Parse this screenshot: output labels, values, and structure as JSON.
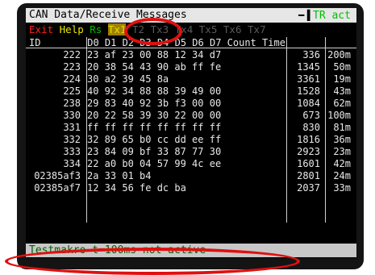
{
  "title": "CAN Data/Receive Messages",
  "tr_icon": "plug-icon",
  "tr_label": "TR act",
  "menu": {
    "exit": "Exit",
    "help": "Help",
    "rs": "Rs",
    "tabs": [
      "Tx1",
      "T2",
      "Tx3",
      "Tx4",
      "Tx5",
      "Tx6",
      "Tx7"
    ],
    "selected_tab": "Tx1"
  },
  "columns": {
    "id": "ID",
    "data": "D0 D1 D2 D3 D4 D5 D6 D7",
    "count": "Count",
    "time": "Time"
  },
  "rows": [
    {
      "id": "222",
      "data": "23 af 23 00 88 12 34 d7",
      "count": "336",
      "time": "200m"
    },
    {
      "id": "223",
      "data": "20 38 54 43 90 ab ff fe",
      "count": "1345",
      "time": "50m"
    },
    {
      "id": "224",
      "data": "30 a2 39 45 8a",
      "count": "3361",
      "time": "19m"
    },
    {
      "id": "225",
      "data": "40 92 34 88 88 39 49 00",
      "count": "1528",
      "time": "43m"
    },
    {
      "id": "238",
      "data": "29 83 40 92 3b f3 00 00",
      "count": "1084",
      "time": "62m"
    },
    {
      "id": "330",
      "data": "20 22 58 39 30 22 00 00",
      "count": "673",
      "time": "100m"
    },
    {
      "id": "331",
      "data": "ff ff ff ff ff ff ff ff",
      "count": "830",
      "time": "81m"
    },
    {
      "id": "332",
      "data": "32 89 65 b0 cc dd ee ff",
      "count": "1816",
      "time": "36m"
    },
    {
      "id": "333",
      "data": "23 84 09 bf 33 87 77 30",
      "count": "2923",
      "time": "23m"
    },
    {
      "id": "334",
      "data": "22 a0 b0 04 57 99 4c ee",
      "count": "1601",
      "time": "42m"
    },
    {
      "id": "02385af3",
      "data": "2a 33 01 b4",
      "count": "2801",
      "time": "24m"
    },
    {
      "id": "02385af7",
      "data": "12 34 56 fe dc ba",
      "count": "2037",
      "time": "33m"
    }
  ],
  "status": "Testmakro t=100ms not active"
}
